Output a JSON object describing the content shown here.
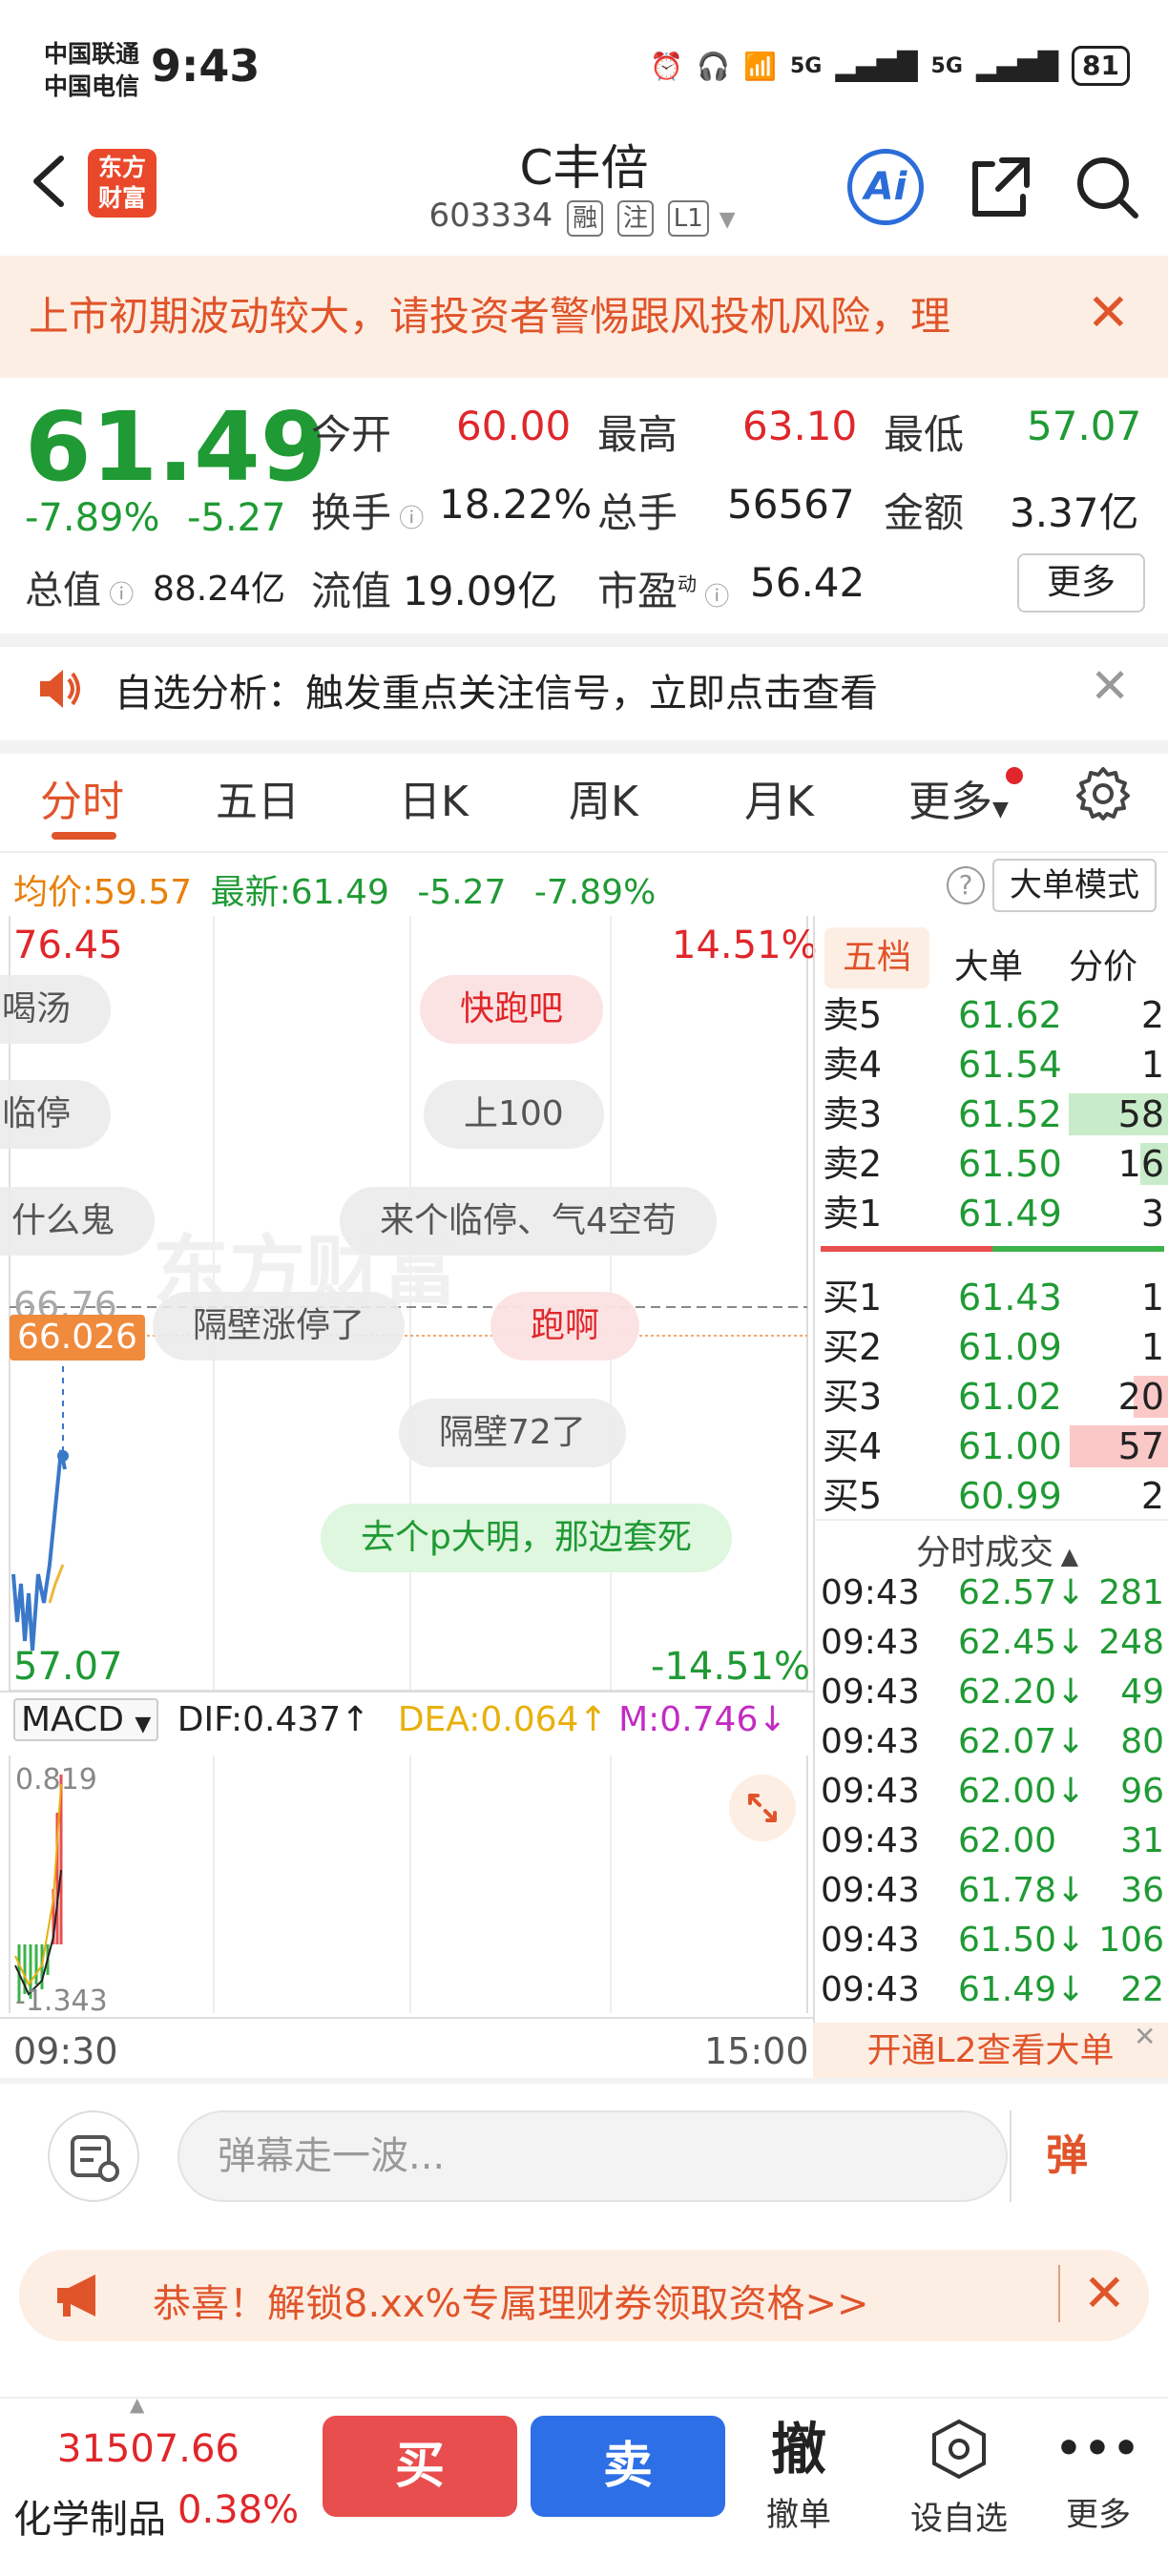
{
  "status": {
    "carrier1": "中国联通",
    "carrier2": "中国电信",
    "time": "9:43",
    "battery": "81",
    "net1": "5G",
    "net2": "5G"
  },
  "header": {
    "back_icon": "back-arrow-icon",
    "logo_line1": "东方",
    "logo_line2": "财富",
    "title": "C丰倍",
    "code": "603334",
    "tags": [
      "融",
      "注",
      "L1"
    ],
    "ai_label": "Ai"
  },
  "warning": {
    "text": "上市初期波动较大，请投资者警惕跟风投机风险，理",
    "close": "✕"
  },
  "quote": {
    "price": "61.49",
    "change_pct": "-7.89%",
    "change_amt": "-5.27",
    "open_label": "今开",
    "open": "60.00",
    "high_label": "最高",
    "high": "63.10",
    "low_label": "最低",
    "low": "57.07",
    "turnover_label": "换手",
    "turnover": "18.22%",
    "volume_label": "总手",
    "volume": "56567",
    "amount_label": "金额",
    "amount": "3.37亿",
    "mktcap_label": "总值",
    "mktcap": "88.24亿",
    "float_label": "流值",
    "float": "19.09亿",
    "pe_label": "市盈",
    "pe_sup": "动",
    "pe": "56.42",
    "more_label": "更多"
  },
  "notice": {
    "text": "自选分析：触发重点关注信号，立即点击查看",
    "close": "✕"
  },
  "tabs": [
    "分时",
    "五日",
    "日K",
    "周K",
    "月K",
    "更多"
  ],
  "avg_bar": {
    "avg_label": "均价:",
    "avg": "59.57",
    "latest_label": "最新:",
    "latest": "61.49",
    "chg": "-5.27",
    "pct": "-7.89%",
    "help": "?",
    "mode_label": "大单模式"
  },
  "chart": {
    "top_price": "76.45",
    "top_pct": "14.51%",
    "bottom_price": "57.07",
    "bottom_pct": "-14.51%",
    "price_tag": "66.026",
    "ref_price": "66.76",
    "danmu": [
      "喝汤",
      "快跑吧",
      "临停",
      "上100",
      "什么鬼",
      "来个临停、气4空苟",
      "隔壁涨停了",
      "跑啊",
      "隔壁72了",
      "去个p大明，那边套死"
    ]
  },
  "book": {
    "tabs": [
      "五档",
      "大单",
      "分价"
    ],
    "asks": [
      {
        "label": "卖5",
        "price": "61.62",
        "vol": "2",
        "bar": 0
      },
      {
        "label": "卖4",
        "price": "61.54",
        "vol": "1",
        "bar": 0
      },
      {
        "label": "卖3",
        "price": "61.52",
        "vol": "58",
        "bar": 0.58
      },
      {
        "label": "卖2",
        "price": "61.50",
        "vol": "16",
        "bar": 0.16
      },
      {
        "label": "卖1",
        "price": "61.49",
        "vol": "3",
        "bar": 0
      }
    ],
    "bids": [
      {
        "label": "买1",
        "price": "61.43",
        "vol": "1",
        "bar": 0
      },
      {
        "label": "买2",
        "price": "61.09",
        "vol": "1",
        "bar": 0
      },
      {
        "label": "买3",
        "price": "61.02",
        "vol": "20",
        "bar": 0.2
      },
      {
        "label": "买4",
        "price": "61.00",
        "vol": "57",
        "bar": 0.57
      },
      {
        "label": "买5",
        "price": "60.99",
        "vol": "2",
        "bar": 0
      }
    ],
    "trades_header": "分时成交",
    "trades": [
      {
        "time": "09:43",
        "price": "62.57↓",
        "vol": "281"
      },
      {
        "time": "09:43",
        "price": "62.45↓",
        "vol": "248"
      },
      {
        "time": "09:43",
        "price": "62.20↓",
        "vol": "49"
      },
      {
        "time": "09:43",
        "price": "62.07↓",
        "vol": "80"
      },
      {
        "time": "09:43",
        "price": "62.00↓",
        "vol": "96"
      },
      {
        "time": "09:43",
        "price": "62.00",
        "vol": "31"
      },
      {
        "time": "09:43",
        "price": "61.78↓",
        "vol": "36"
      },
      {
        "time": "09:43",
        "price": "61.50↓",
        "vol": "106"
      },
      {
        "time": "09:43",
        "price": "61.49↓",
        "vol": "22"
      }
    ],
    "l2_label": "开通L2查看大单"
  },
  "macd": {
    "name": "MACD",
    "dif": "DIF:0.437↑",
    "dea": "DEA:0.064↑",
    "m": "M:0.746↓",
    "top": "0.819",
    "bottom": "-1.343"
  },
  "time_axis": {
    "start": "09:30",
    "end": "15:00"
  },
  "input": {
    "placeholder": "弹幕走一波...",
    "send": "弹"
  },
  "promo": {
    "text": "恭喜！解锁8.xx%专属理财券领取资格>>",
    "close": "✕"
  },
  "bottom": {
    "index_value": "31507.66",
    "index_name": "化学制品",
    "index_pct": "0.38%",
    "buy": "买",
    "sell": "卖",
    "items": [
      {
        "icon": "撤",
        "label": "撤单"
      },
      {
        "icon": "◎",
        "label": "设自选"
      },
      {
        "icon": "•••",
        "label": "更多"
      }
    ]
  }
}
